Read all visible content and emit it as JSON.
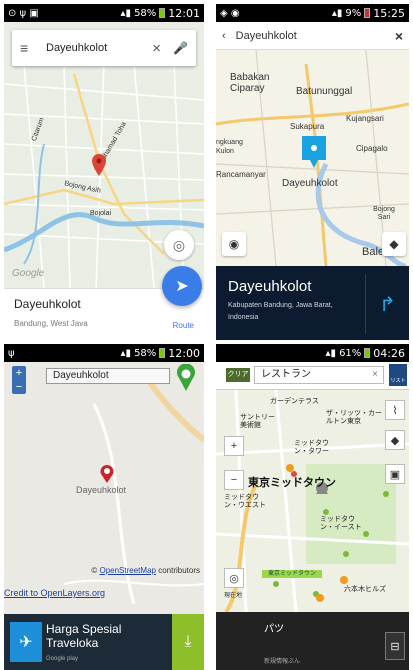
{
  "panel1": {
    "status": {
      "battery": "58%",
      "time": "12:01"
    },
    "search": {
      "query": "Dayeuhkolot"
    },
    "map_labels": [
      "Jl. Mohamad Toha",
      "Bojong Asih",
      "Bojolai",
      "Citarum",
      "Google"
    ],
    "place": {
      "name": "Dayeuhkolot",
      "subtitle": "Bandung, West Java",
      "route": "Route"
    }
  },
  "panel2": {
    "status": {
      "battery": "9%",
      "time": "15:25"
    },
    "search": {
      "query": "Dayeuhkolot"
    },
    "map_labels": [
      "Babakan Ciparay",
      "Batununggal",
      "Sukapura",
      "Kujangsari",
      "ngkuang Kulon",
      "Cipagalo",
      "Rancamanyar",
      "Dayeuhkolot",
      "Bojong Sari",
      "Baleend"
    ],
    "card": {
      "name": "Dayeuhkolot",
      "address": "Kabupaten Bandung, Jawa Barat, Indonesia"
    }
  },
  "panel3": {
    "status": {
      "battery": "58%",
      "time": "12:00"
    },
    "zoom": {
      "plus": "+",
      "minus": "−"
    },
    "search": {
      "query": "Dayeuhkolot"
    },
    "place_label": "Dayeuhkolot",
    "attribution": {
      "prefix": "©",
      "link": "OpenStreetMap",
      "suffix": "contributors"
    },
    "credit_link": "Credit to OpenLayers.org",
    "ad": {
      "title": "Harga Spesial Traveloka",
      "store": "Google play"
    }
  },
  "panel4": {
    "status": {
      "battery": "61%",
      "time": "04:26"
    },
    "clear_label": "クリア",
    "search": {
      "query": "レストラン"
    },
    "list_label": "リスト",
    "main_label": "東京ミッドタウン",
    "map_labels": [
      "ガーデンテラス",
      "サントリー美術館",
      "ザ・リッツ・カールトン東京",
      "ミッドタウン・タワー",
      "ミッドタウン・イースト",
      "ミッドタウン・ウエスト",
      "六本木ヒルズ"
    ],
    "now_label": "現在地",
    "green_label": "東京ミッドタウン",
    "bottom": {
      "label": "パツ",
      "small": "新規情報ぶん"
    },
    "colors": {
      "header_green": "#4d6b2a",
      "list_blue": "#1f4a80"
    }
  }
}
